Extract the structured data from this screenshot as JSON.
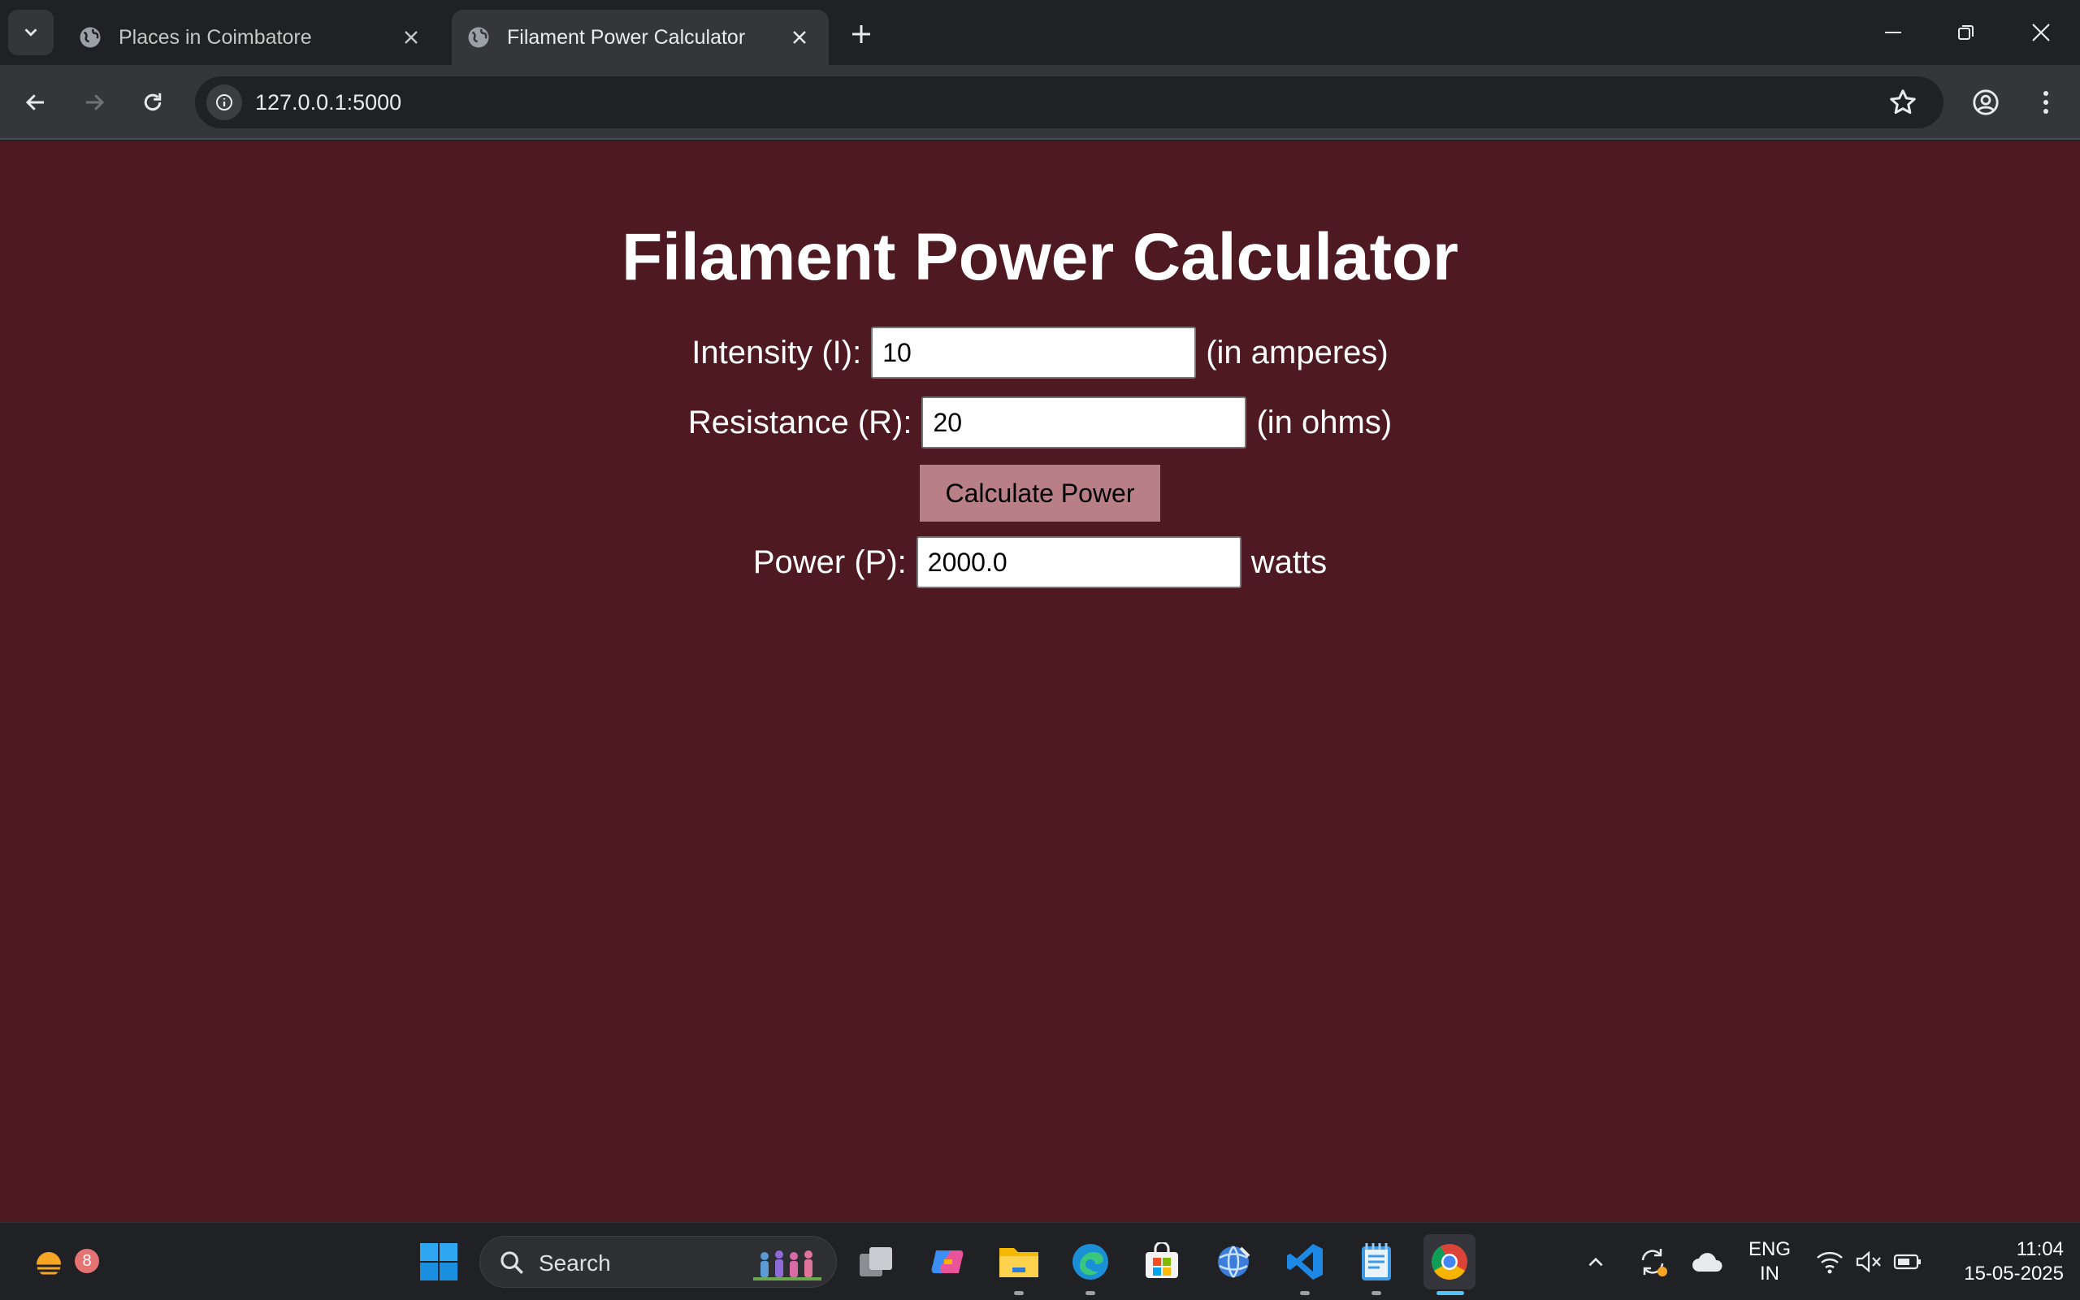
{
  "browser": {
    "tabs": [
      {
        "title": "Places in Coimbatore",
        "active": false
      },
      {
        "title": "Filament Power Calculator",
        "active": true
      }
    ],
    "url": "127.0.0.1:5000"
  },
  "page": {
    "background": "#4e1920",
    "title": "Filament Power Calculator",
    "intensity": {
      "label": "Intensity (I):",
      "value": "10",
      "unit": "(in amperes)"
    },
    "resistance": {
      "label": "Resistance (R):",
      "value": "20",
      "unit": "(in ohms)"
    },
    "calculate_label": "Calculate Power",
    "power": {
      "label": "Power (P):",
      "value": "2000.0",
      "unit": "watts"
    }
  },
  "taskbar": {
    "search_placeholder": "Search",
    "weather_badge": "8",
    "language": {
      "line1": "ENG",
      "line2": "IN"
    },
    "time": "11:04",
    "date": "15-05-2025"
  }
}
